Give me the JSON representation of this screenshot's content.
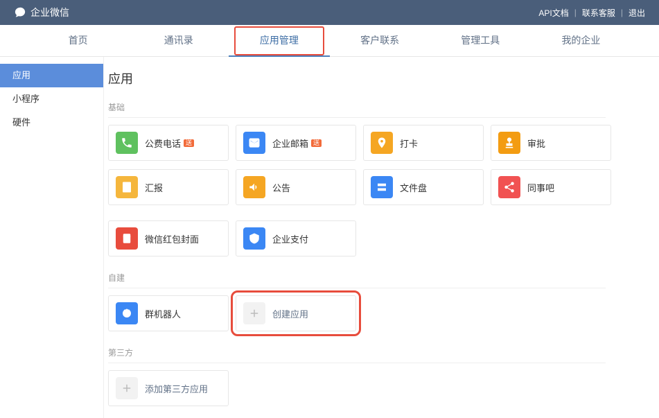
{
  "brand": "企业微信",
  "top_links": {
    "docs": "API文档",
    "support": "联系客服",
    "logout": "退出"
  },
  "nav": {
    "home": "首页",
    "contacts": "通讯录",
    "apps": "应用管理",
    "customer": "客户联系",
    "tools": "管理工具",
    "myorg": "我的企业"
  },
  "sidebar": {
    "apps": "应用",
    "miniprograms": "小程序",
    "hardware": "硬件"
  },
  "page_title": "应用",
  "section": {
    "basic": "基础",
    "self": "自建",
    "third": "第三方"
  },
  "badges": {
    "fei": "送",
    "song": "送"
  },
  "apps": {
    "phone": "公费电话",
    "mail": "企业邮箱",
    "checkin": "打卡",
    "approval": "审批",
    "report": "汇报",
    "announcement": "公告",
    "filedisk": "文件盘",
    "colleague": "同事吧",
    "redpacket": "微信红包封面",
    "pay": "企业支付"
  },
  "self_apps": {
    "bot": "群机器人",
    "create": "创建应用"
  },
  "third_apps": {
    "add": "添加第三方应用"
  }
}
